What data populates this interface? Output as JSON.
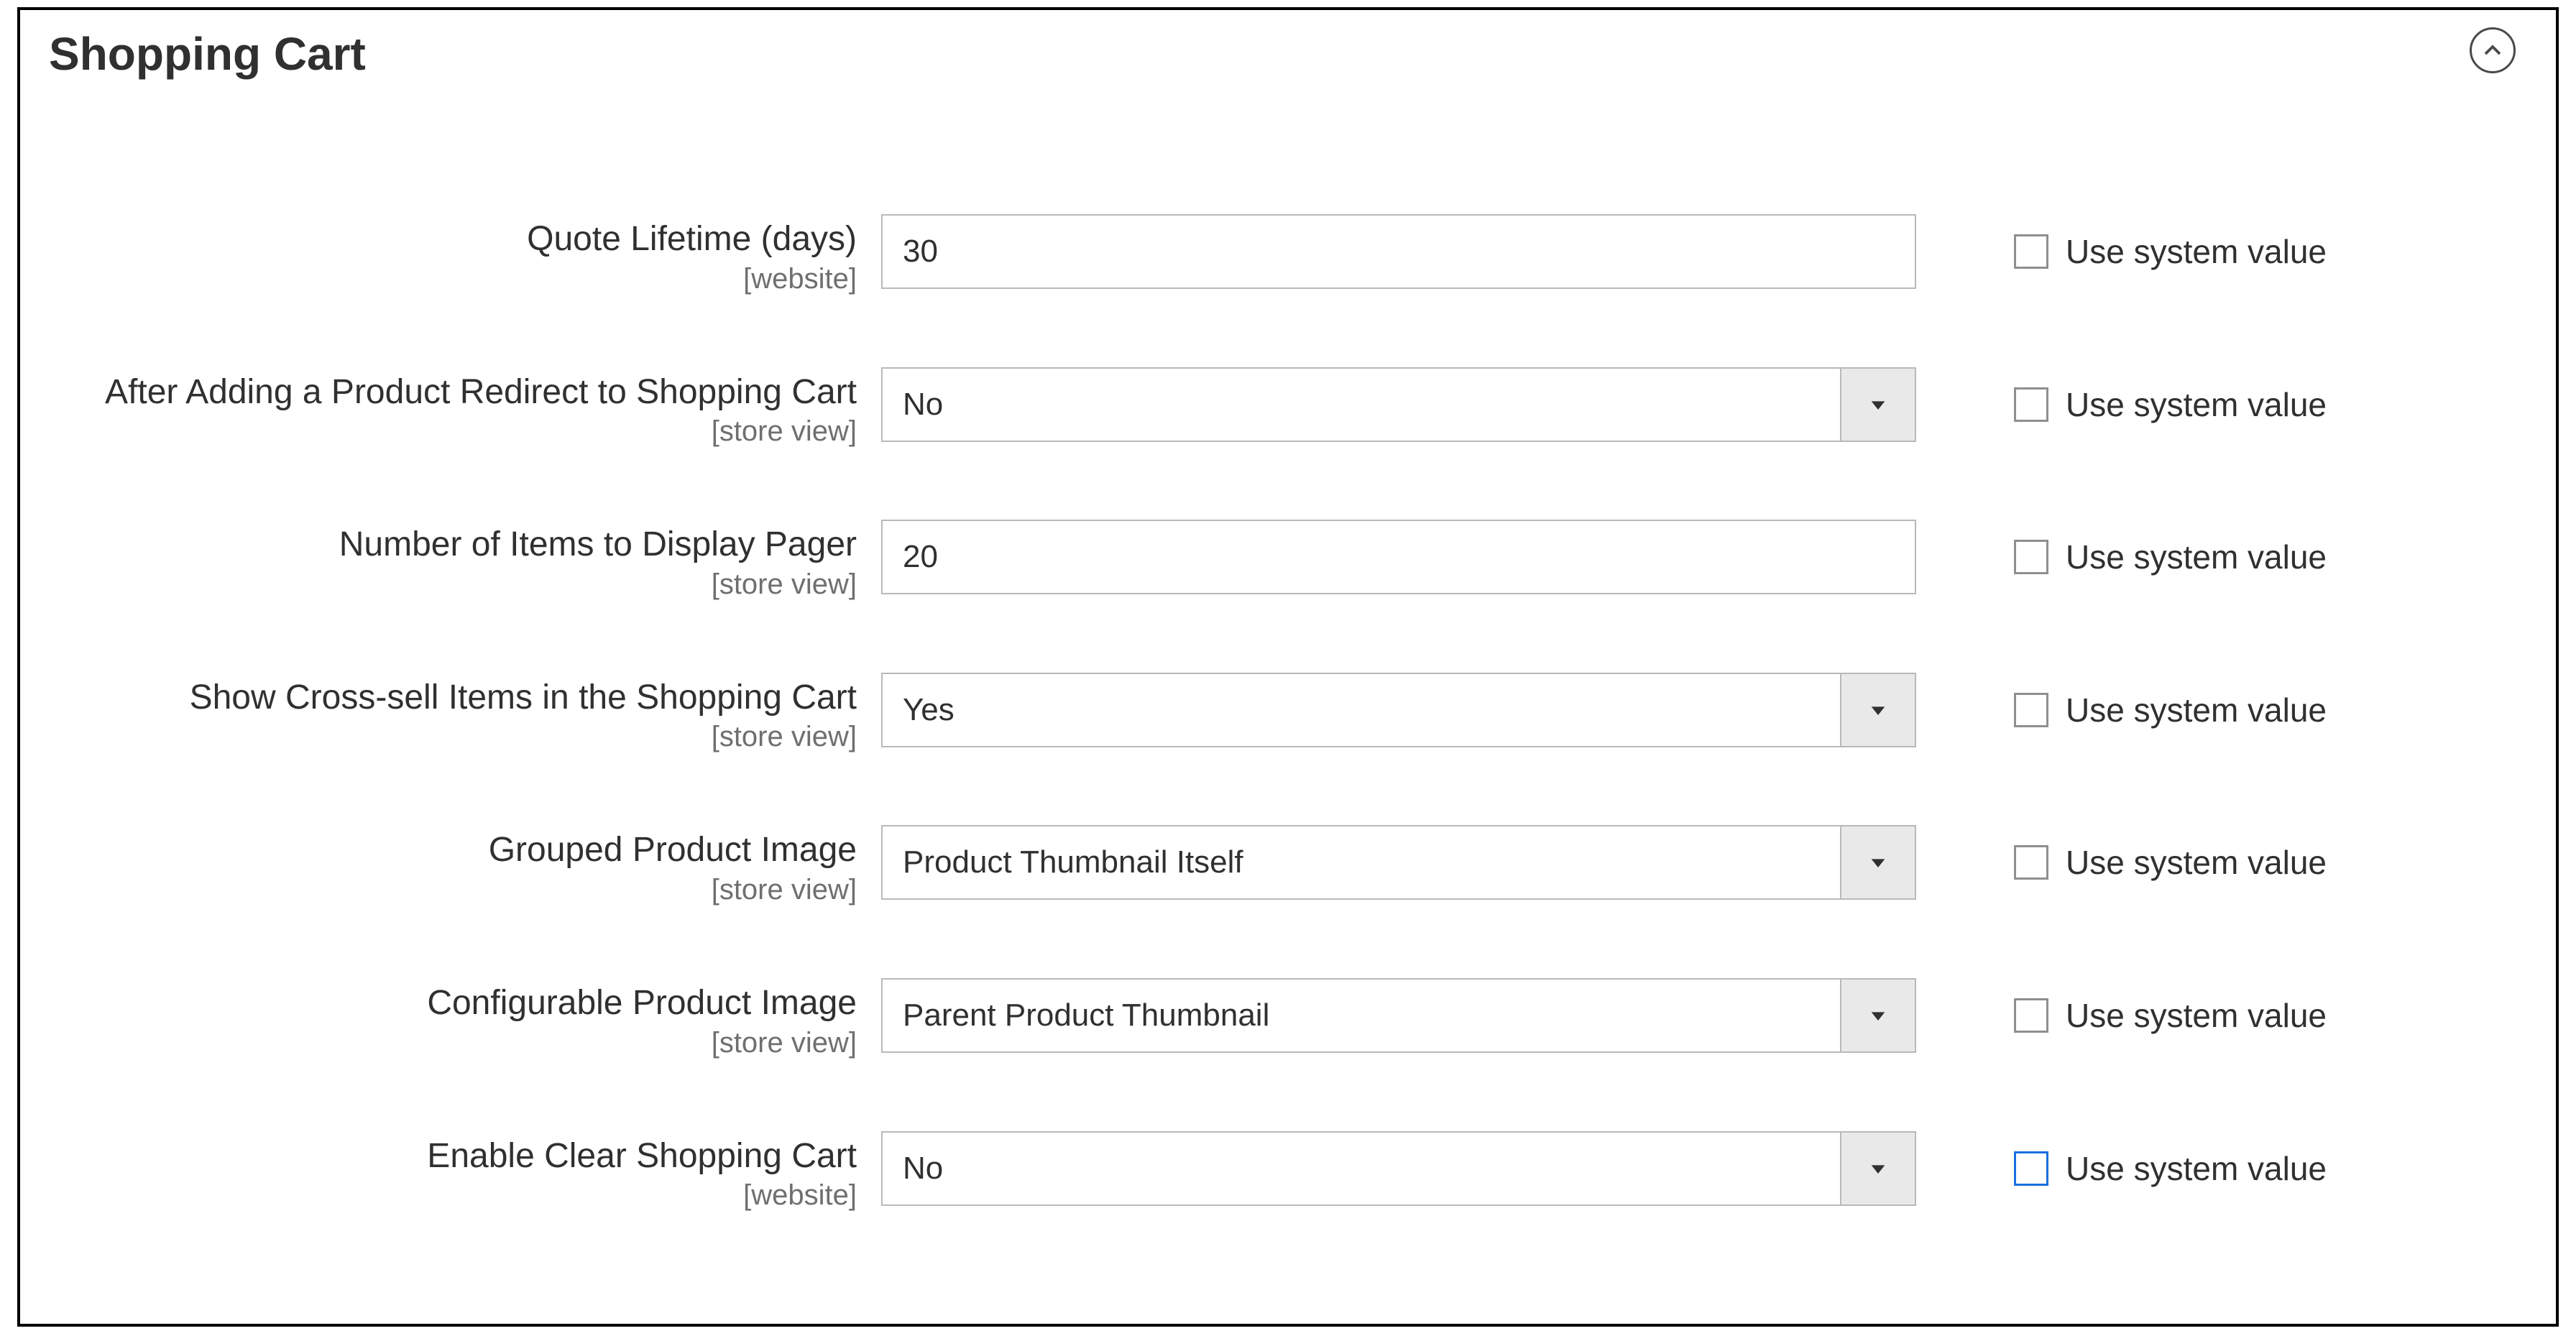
{
  "section": {
    "title": "Shopping Cart"
  },
  "sysValueLabel": "Use system value",
  "fields": {
    "quote_lifetime": {
      "label": "Quote Lifetime (days)",
      "scope": "[website]",
      "value": "30"
    },
    "redirect_to_cart": {
      "label": "After Adding a Product Redirect to Shopping Cart",
      "scope": "[store view]",
      "value": "No"
    },
    "pager_items": {
      "label": "Number of Items to Display Pager",
      "scope": "[store view]",
      "value": "20"
    },
    "cross_sell": {
      "label": "Show Cross-sell Items in the Shopping Cart",
      "scope": "[store view]",
      "value": "Yes"
    },
    "grouped_image": {
      "label": "Grouped Product Image",
      "scope": "[store view]",
      "value": "Product Thumbnail Itself"
    },
    "configurable_image": {
      "label": "Configurable Product Image",
      "scope": "[store view]",
      "value": "Parent Product Thumbnail"
    },
    "clear_cart": {
      "label": "Enable Clear Shopping Cart",
      "scope": "[website]",
      "value": "No"
    }
  }
}
